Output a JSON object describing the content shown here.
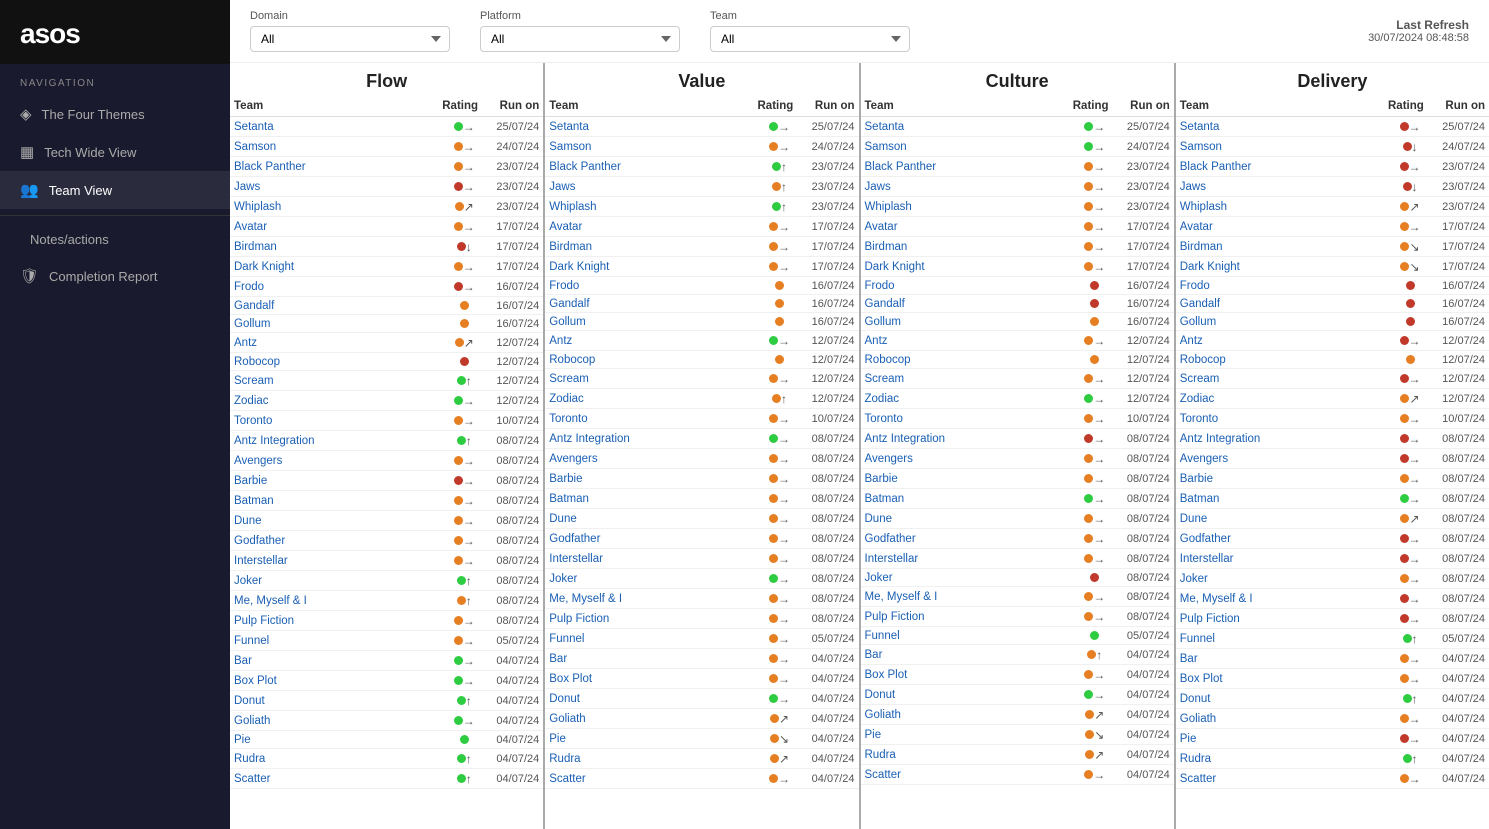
{
  "sidebar": {
    "logo": "asos",
    "nav_label": "NAVIGATION",
    "items": [
      {
        "id": "four-themes",
        "label": "The Four Themes",
        "icon": "◈",
        "active": false
      },
      {
        "id": "tech-wide",
        "label": "Tech Wide View",
        "icon": "▦",
        "active": false
      },
      {
        "id": "team-view",
        "label": "Team View",
        "icon": "👥",
        "active": true
      },
      {
        "id": "notes",
        "label": "Notes/actions",
        "active": false
      },
      {
        "id": "completion",
        "label": "Completion Report",
        "icon": "🛡",
        "active": false
      }
    ]
  },
  "header": {
    "domain_label": "Domain",
    "domain_value": "All",
    "platform_label": "Platform",
    "platform_value": "All",
    "team_label": "Team",
    "team_value": "All",
    "last_refresh_label": "Last Refresh",
    "last_refresh_value": "30/07/2024 08:48:58"
  },
  "sections": [
    {
      "title": "Flow",
      "col_team": "Team",
      "col_rating": "Rating",
      "col_runon": "Run on",
      "rows": [
        {
          "team": "Setanta",
          "dot": "green",
          "arrow": "→",
          "date": "25/07/24"
        },
        {
          "team": "Samson",
          "dot": "orange",
          "arrow": "→",
          "date": "24/07/24"
        },
        {
          "team": "Black Panther",
          "dot": "orange",
          "arrow": "→",
          "date": "23/07/24"
        },
        {
          "team": "Jaws",
          "dot": "red",
          "arrow": "→",
          "date": "23/07/24"
        },
        {
          "team": "Whiplash",
          "dot": "orange",
          "arrow": "↗",
          "date": "23/07/24"
        },
        {
          "team": "Avatar",
          "dot": "orange",
          "arrow": "→",
          "date": "17/07/24"
        },
        {
          "team": "Birdman",
          "dot": "red",
          "arrow": "↓",
          "date": "17/07/24"
        },
        {
          "team": "Dark Knight",
          "dot": "orange",
          "arrow": "→",
          "date": "17/07/24"
        },
        {
          "team": "Frodo",
          "dot": "red",
          "arrow": "→",
          "date": "16/07/24"
        },
        {
          "team": "Gandalf",
          "dot": "orange",
          "arrow": "",
          "date": "16/07/24"
        },
        {
          "team": "Gollum",
          "dot": "orange",
          "arrow": "",
          "date": "16/07/24"
        },
        {
          "team": "Antz",
          "dot": "orange",
          "arrow": "↗",
          "date": "12/07/24"
        },
        {
          "team": "Robocop",
          "dot": "red",
          "arrow": "",
          "date": "12/07/24"
        },
        {
          "team": "Scream",
          "dot": "green",
          "arrow": "↑",
          "date": "12/07/24"
        },
        {
          "team": "Zodiac",
          "dot": "green",
          "arrow": "→",
          "date": "12/07/24"
        },
        {
          "team": "Toronto",
          "dot": "orange",
          "arrow": "→",
          "date": "10/07/24"
        },
        {
          "team": "Antz Integration",
          "dot": "green",
          "arrow": "↑",
          "date": "08/07/24"
        },
        {
          "team": "Avengers",
          "dot": "orange",
          "arrow": "→",
          "date": "08/07/24"
        },
        {
          "team": "Barbie",
          "dot": "red",
          "arrow": "→",
          "date": "08/07/24"
        },
        {
          "team": "Batman",
          "dot": "orange",
          "arrow": "→",
          "date": "08/07/24"
        },
        {
          "team": "Dune",
          "dot": "orange",
          "arrow": "→",
          "date": "08/07/24"
        },
        {
          "team": "Godfather",
          "dot": "orange",
          "arrow": "→",
          "date": "08/07/24"
        },
        {
          "team": "Interstellar",
          "dot": "orange",
          "arrow": "→",
          "date": "08/07/24"
        },
        {
          "team": "Joker",
          "dot": "green",
          "arrow": "↑",
          "date": "08/07/24"
        },
        {
          "team": "Me, Myself & I",
          "dot": "orange",
          "arrow": "↑",
          "date": "08/07/24"
        },
        {
          "team": "Pulp Fiction",
          "dot": "orange",
          "arrow": "→",
          "date": "08/07/24"
        },
        {
          "team": "Funnel",
          "dot": "orange",
          "arrow": "→",
          "date": "05/07/24"
        },
        {
          "team": "Bar",
          "dot": "green",
          "arrow": "→",
          "date": "04/07/24"
        },
        {
          "team": "Box Plot",
          "dot": "green",
          "arrow": "→",
          "date": "04/07/24"
        },
        {
          "team": "Donut",
          "dot": "green",
          "arrow": "↑",
          "date": "04/07/24"
        },
        {
          "team": "Goliath",
          "dot": "green",
          "arrow": "→",
          "date": "04/07/24"
        },
        {
          "team": "Pie",
          "dot": "green",
          "arrow": "",
          "date": "04/07/24"
        },
        {
          "team": "Rudra",
          "dot": "green",
          "arrow": "↑",
          "date": "04/07/24"
        },
        {
          "team": "Scatter",
          "dot": "green",
          "arrow": "↑",
          "date": "04/07/24"
        }
      ]
    },
    {
      "title": "Value",
      "col_team": "Team",
      "col_rating": "Rating",
      "col_runon": "Run on",
      "rows": [
        {
          "team": "Setanta",
          "dot": "green",
          "arrow": "→",
          "date": "25/07/24"
        },
        {
          "team": "Samson",
          "dot": "orange",
          "arrow": "→",
          "date": "24/07/24"
        },
        {
          "team": "Black Panther",
          "dot": "green",
          "arrow": "↑",
          "date": "23/07/24"
        },
        {
          "team": "Jaws",
          "dot": "orange",
          "arrow": "↑",
          "date": "23/07/24"
        },
        {
          "team": "Whiplash",
          "dot": "green",
          "arrow": "↑",
          "date": "23/07/24"
        },
        {
          "team": "Avatar",
          "dot": "orange",
          "arrow": "→",
          "date": "17/07/24"
        },
        {
          "team": "Birdman",
          "dot": "orange",
          "arrow": "→",
          "date": "17/07/24"
        },
        {
          "team": "Dark Knight",
          "dot": "orange",
          "arrow": "→",
          "date": "17/07/24"
        },
        {
          "team": "Frodo",
          "dot": "orange",
          "arrow": "",
          "date": "16/07/24"
        },
        {
          "team": "Gandalf",
          "dot": "orange",
          "arrow": "",
          "date": "16/07/24"
        },
        {
          "team": "Gollum",
          "dot": "orange",
          "arrow": "",
          "date": "16/07/24"
        },
        {
          "team": "Antz",
          "dot": "green",
          "arrow": "→",
          "date": "12/07/24"
        },
        {
          "team": "Robocop",
          "dot": "orange",
          "arrow": "",
          "date": "12/07/24"
        },
        {
          "team": "Scream",
          "dot": "orange",
          "arrow": "→",
          "date": "12/07/24"
        },
        {
          "team": "Zodiac",
          "dot": "orange",
          "arrow": "↑",
          "date": "12/07/24"
        },
        {
          "team": "Toronto",
          "dot": "orange",
          "arrow": "→",
          "date": "10/07/24"
        },
        {
          "team": "Antz Integration",
          "dot": "green",
          "arrow": "→",
          "date": "08/07/24"
        },
        {
          "team": "Avengers",
          "dot": "orange",
          "arrow": "→",
          "date": "08/07/24"
        },
        {
          "team": "Barbie",
          "dot": "orange",
          "arrow": "→",
          "date": "08/07/24"
        },
        {
          "team": "Batman",
          "dot": "orange",
          "arrow": "→",
          "date": "08/07/24"
        },
        {
          "team": "Dune",
          "dot": "orange",
          "arrow": "→",
          "date": "08/07/24"
        },
        {
          "team": "Godfather",
          "dot": "orange",
          "arrow": "→",
          "date": "08/07/24"
        },
        {
          "team": "Interstellar",
          "dot": "orange",
          "arrow": "→",
          "date": "08/07/24"
        },
        {
          "team": "Joker",
          "dot": "green",
          "arrow": "→",
          "date": "08/07/24"
        },
        {
          "team": "Me, Myself & I",
          "dot": "orange",
          "arrow": "→",
          "date": "08/07/24"
        },
        {
          "team": "Pulp Fiction",
          "dot": "orange",
          "arrow": "→",
          "date": "08/07/24"
        },
        {
          "team": "Funnel",
          "dot": "orange",
          "arrow": "→",
          "date": "05/07/24"
        },
        {
          "team": "Bar",
          "dot": "orange",
          "arrow": "→",
          "date": "04/07/24"
        },
        {
          "team": "Box Plot",
          "dot": "orange",
          "arrow": "→",
          "date": "04/07/24"
        },
        {
          "team": "Donut",
          "dot": "green",
          "arrow": "→",
          "date": "04/07/24"
        },
        {
          "team": "Goliath",
          "dot": "orange",
          "arrow": "↗",
          "date": "04/07/24"
        },
        {
          "team": "Pie",
          "dot": "orange",
          "arrow": "↘",
          "date": "04/07/24"
        },
        {
          "team": "Rudra",
          "dot": "orange",
          "arrow": "↗",
          "date": "04/07/24"
        },
        {
          "team": "Scatter",
          "dot": "orange",
          "arrow": "→",
          "date": "04/07/24"
        }
      ]
    },
    {
      "title": "Culture",
      "col_team": "Team",
      "col_rating": "Rating",
      "col_runon": "Run on",
      "rows": [
        {
          "team": "Setanta",
          "dot": "green",
          "arrow": "→",
          "date": "25/07/24"
        },
        {
          "team": "Samson",
          "dot": "green",
          "arrow": "→",
          "date": "24/07/24"
        },
        {
          "team": "Black Panther",
          "dot": "orange",
          "arrow": "→",
          "date": "23/07/24"
        },
        {
          "team": "Jaws",
          "dot": "orange",
          "arrow": "→",
          "date": "23/07/24"
        },
        {
          "team": "Whiplash",
          "dot": "orange",
          "arrow": "→",
          "date": "23/07/24"
        },
        {
          "team": "Avatar",
          "dot": "orange",
          "arrow": "→",
          "date": "17/07/24"
        },
        {
          "team": "Birdman",
          "dot": "orange",
          "arrow": "→",
          "date": "17/07/24"
        },
        {
          "team": "Dark Knight",
          "dot": "orange",
          "arrow": "→",
          "date": "17/07/24"
        },
        {
          "team": "Frodo",
          "dot": "red",
          "arrow": "",
          "date": "16/07/24"
        },
        {
          "team": "Gandalf",
          "dot": "red",
          "arrow": "",
          "date": "16/07/24"
        },
        {
          "team": "Gollum",
          "dot": "orange",
          "arrow": "",
          "date": "16/07/24"
        },
        {
          "team": "Antz",
          "dot": "orange",
          "arrow": "→",
          "date": "12/07/24"
        },
        {
          "team": "Robocop",
          "dot": "orange",
          "arrow": "",
          "date": "12/07/24"
        },
        {
          "team": "Scream",
          "dot": "orange",
          "arrow": "→",
          "date": "12/07/24"
        },
        {
          "team": "Zodiac",
          "dot": "green",
          "arrow": "→",
          "date": "12/07/24"
        },
        {
          "team": "Toronto",
          "dot": "orange",
          "arrow": "→",
          "date": "10/07/24"
        },
        {
          "team": "Antz Integration",
          "dot": "red",
          "arrow": "→",
          "date": "08/07/24"
        },
        {
          "team": "Avengers",
          "dot": "orange",
          "arrow": "→",
          "date": "08/07/24"
        },
        {
          "team": "Barbie",
          "dot": "orange",
          "arrow": "→",
          "date": "08/07/24"
        },
        {
          "team": "Batman",
          "dot": "green",
          "arrow": "→",
          "date": "08/07/24"
        },
        {
          "team": "Dune",
          "dot": "orange",
          "arrow": "→",
          "date": "08/07/24"
        },
        {
          "team": "Godfather",
          "dot": "orange",
          "arrow": "→",
          "date": "08/07/24"
        },
        {
          "team": "Interstellar",
          "dot": "orange",
          "arrow": "→",
          "date": "08/07/24"
        },
        {
          "team": "Joker",
          "dot": "red",
          "arrow": "",
          "date": "08/07/24"
        },
        {
          "team": "Me, Myself & I",
          "dot": "orange",
          "arrow": "→",
          "date": "08/07/24"
        },
        {
          "team": "Pulp Fiction",
          "dot": "orange",
          "arrow": "→",
          "date": "08/07/24"
        },
        {
          "team": "Funnel",
          "dot": "green",
          "arrow": "",
          "date": "05/07/24"
        },
        {
          "team": "Bar",
          "dot": "orange",
          "arrow": "↑",
          "date": "04/07/24"
        },
        {
          "team": "Box Plot",
          "dot": "orange",
          "arrow": "→",
          "date": "04/07/24"
        },
        {
          "team": "Donut",
          "dot": "green",
          "arrow": "→",
          "date": "04/07/24"
        },
        {
          "team": "Goliath",
          "dot": "orange",
          "arrow": "↗",
          "date": "04/07/24"
        },
        {
          "team": "Pie",
          "dot": "orange",
          "arrow": "↘",
          "date": "04/07/24"
        },
        {
          "team": "Rudra",
          "dot": "orange",
          "arrow": "↗",
          "date": "04/07/24"
        },
        {
          "team": "Scatter",
          "dot": "orange",
          "arrow": "→",
          "date": "04/07/24"
        }
      ]
    },
    {
      "title": "Delivery",
      "col_team": "Team",
      "col_rating": "Rating",
      "col_runon": "Run on",
      "rows": [
        {
          "team": "Setanta",
          "dot": "red",
          "arrow": "→",
          "date": "25/07/24"
        },
        {
          "team": "Samson",
          "dot": "red",
          "arrow": "↓",
          "date": "24/07/24"
        },
        {
          "team": "Black Panther",
          "dot": "red",
          "arrow": "→",
          "date": "23/07/24"
        },
        {
          "team": "Jaws",
          "dot": "red",
          "arrow": "↓",
          "date": "23/07/24"
        },
        {
          "team": "Whiplash",
          "dot": "orange",
          "arrow": "↗",
          "date": "23/07/24"
        },
        {
          "team": "Avatar",
          "dot": "orange",
          "arrow": "→",
          "date": "17/07/24"
        },
        {
          "team": "Birdman",
          "dot": "orange",
          "arrow": "↘",
          "date": "17/07/24"
        },
        {
          "team": "Dark Knight",
          "dot": "orange",
          "arrow": "↘",
          "date": "17/07/24"
        },
        {
          "team": "Frodo",
          "dot": "red",
          "arrow": "",
          "date": "16/07/24"
        },
        {
          "team": "Gandalf",
          "dot": "red",
          "arrow": "",
          "date": "16/07/24"
        },
        {
          "team": "Gollum",
          "dot": "red",
          "arrow": "",
          "date": "16/07/24"
        },
        {
          "team": "Antz",
          "dot": "red",
          "arrow": "→",
          "date": "12/07/24"
        },
        {
          "team": "Robocop",
          "dot": "orange",
          "arrow": "",
          "date": "12/07/24"
        },
        {
          "team": "Scream",
          "dot": "red",
          "arrow": "→",
          "date": "12/07/24"
        },
        {
          "team": "Zodiac",
          "dot": "orange",
          "arrow": "↗",
          "date": "12/07/24"
        },
        {
          "team": "Toronto",
          "dot": "orange",
          "arrow": "→",
          "date": "10/07/24"
        },
        {
          "team": "Antz Integration",
          "dot": "red",
          "arrow": "→",
          "date": "08/07/24"
        },
        {
          "team": "Avengers",
          "dot": "red",
          "arrow": "→",
          "date": "08/07/24"
        },
        {
          "team": "Barbie",
          "dot": "orange",
          "arrow": "→",
          "date": "08/07/24"
        },
        {
          "team": "Batman",
          "dot": "green",
          "arrow": "→",
          "date": "08/07/24"
        },
        {
          "team": "Dune",
          "dot": "orange",
          "arrow": "↗",
          "date": "08/07/24"
        },
        {
          "team": "Godfather",
          "dot": "red",
          "arrow": "→",
          "date": "08/07/24"
        },
        {
          "team": "Interstellar",
          "dot": "red",
          "arrow": "→",
          "date": "08/07/24"
        },
        {
          "team": "Joker",
          "dot": "orange",
          "arrow": "→",
          "date": "08/07/24"
        },
        {
          "team": "Me, Myself & I",
          "dot": "red",
          "arrow": "→",
          "date": "08/07/24"
        },
        {
          "team": "Pulp Fiction",
          "dot": "red",
          "arrow": "→",
          "date": "08/07/24"
        },
        {
          "team": "Funnel",
          "dot": "green",
          "arrow": "↑",
          "date": "05/07/24"
        },
        {
          "team": "Bar",
          "dot": "orange",
          "arrow": "→",
          "date": "04/07/24"
        },
        {
          "team": "Box Plot",
          "dot": "orange",
          "arrow": "→",
          "date": "04/07/24"
        },
        {
          "team": "Donut",
          "dot": "green",
          "arrow": "↑",
          "date": "04/07/24"
        },
        {
          "team": "Goliath",
          "dot": "orange",
          "arrow": "→",
          "date": "04/07/24"
        },
        {
          "team": "Pie",
          "dot": "red",
          "arrow": "→",
          "date": "04/07/24"
        },
        {
          "team": "Rudra",
          "dot": "green",
          "arrow": "↑",
          "date": "04/07/24"
        },
        {
          "team": "Scatter",
          "dot": "orange",
          "arrow": "→",
          "date": "04/07/24"
        }
      ]
    }
  ],
  "dot_colors": {
    "green": "#2ecc40",
    "orange": "#e67e22",
    "red": "#c0392b"
  }
}
